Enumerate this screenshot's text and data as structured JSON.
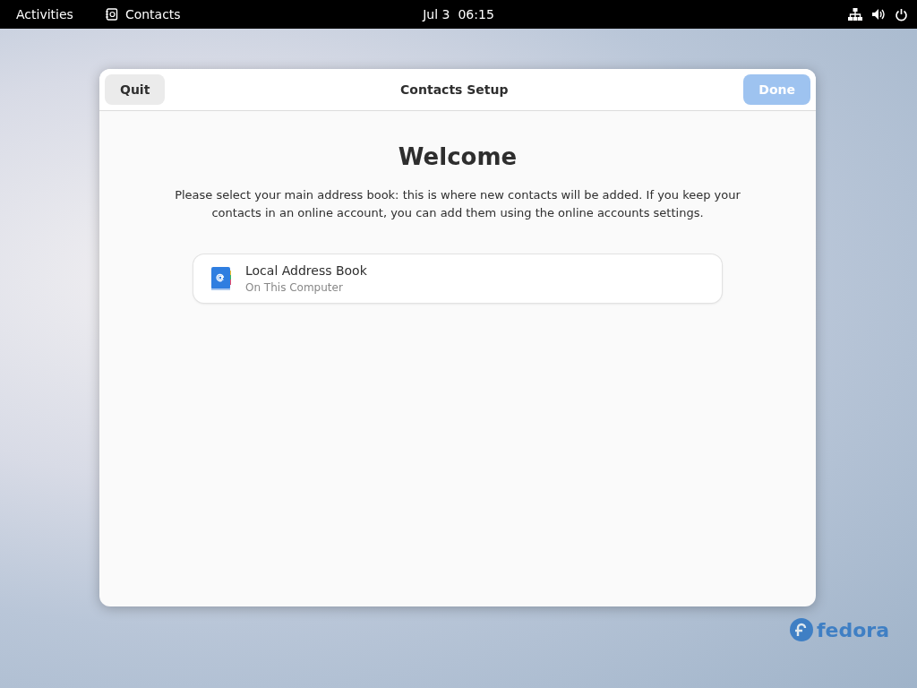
{
  "top_bar": {
    "activities": "Activities",
    "app_name": "Contacts",
    "date": "Jul 3",
    "time": "06:15"
  },
  "window": {
    "title": "Contacts Setup",
    "quit_button": "Quit",
    "done_button": {
      "label": "Done",
      "disabled": true
    }
  },
  "heading": "Welcome",
  "description": "Please select your main address book: this is where new contacts will be added. If you keep your contacts in an online account, you can add them using the online accounts settings.",
  "address_books": [
    {
      "name": "Local Address Book",
      "location": "On This Computer"
    }
  ],
  "wallpaper": {
    "logo_text": "fedora"
  }
}
